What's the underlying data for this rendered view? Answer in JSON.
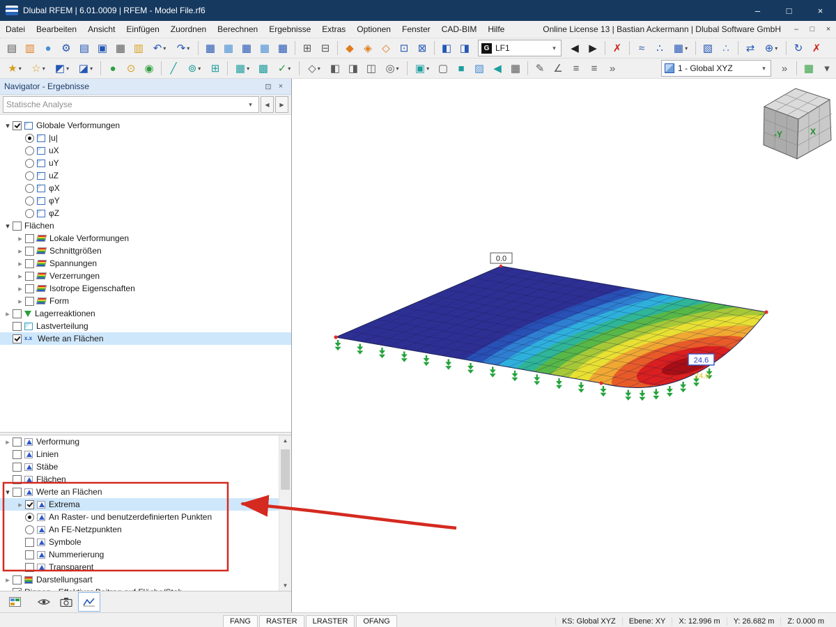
{
  "ui": {
    "dropdown_arrow": "▾",
    "nav_left": "◀",
    "nav_right": "▶",
    "scroll_up": "▲",
    "scroll_down": "▼",
    "minimize_glyph": "–",
    "restore_glyph": "□",
    "close_glyph": "×",
    "float_glyph": "⊡"
  },
  "titlebar": {
    "title": "Dlubal RFEM | 6.01.0009 | RFEM - Model File.rf6"
  },
  "menubar": {
    "items": [
      {
        "name": "menu-datei",
        "label": "Datei"
      },
      {
        "name": "menu-bearbeiten",
        "label": "Bearbeiten"
      },
      {
        "name": "menu-ansicht",
        "label": "Ansicht"
      },
      {
        "name": "menu-einfuegen",
        "label": "Einfügen"
      },
      {
        "name": "menu-zuordnen",
        "label": "Zuordnen"
      },
      {
        "name": "menu-berechnen",
        "label": "Berechnen"
      },
      {
        "name": "menu-ergebnisse",
        "label": "Ergebnisse"
      },
      {
        "name": "menu-extras",
        "label": "Extras"
      },
      {
        "name": "menu-optionen",
        "label": "Optionen"
      },
      {
        "name": "menu-fenster",
        "label": "Fenster"
      },
      {
        "name": "menu-cad-bim",
        "label": "CAD-BIM"
      },
      {
        "name": "menu-hilfe",
        "label": "Hilfe"
      }
    ],
    "right_text": "Online License 13 | Bastian Ackermann | Dlubal Software GmbH"
  },
  "toolbar1": {
    "icons_left": [
      {
        "name": "new-model-icon",
        "glyph": "▤",
        "cls": "c-gray"
      },
      {
        "name": "paste-icon",
        "glyph": "▥",
        "cls": "c-orange"
      },
      {
        "name": "dlubal-online-icon",
        "glyph": "●",
        "cls": "c-lblue"
      },
      {
        "name": "settings-icon",
        "glyph": "⚙",
        "cls": "c-blue"
      },
      {
        "name": "print-preview-icon",
        "glyph": "▤",
        "cls": "c-blue"
      },
      {
        "name": "save-icon",
        "glyph": "▣",
        "cls": "c-blue"
      },
      {
        "name": "print-icon",
        "glyph": "▦",
        "cls": "c-gray"
      },
      {
        "name": "comment-icon",
        "glyph": "▥",
        "cls": "c-yellow"
      },
      {
        "name": "undo-icon",
        "glyph": "↶",
        "cls": "c-blue has-dd"
      },
      {
        "name": "redo-icon",
        "glyph": "↷",
        "cls": "c-blue has-dd"
      },
      {
        "name": "separator",
        "cls": "sep"
      },
      {
        "name": "tables-results-icon",
        "glyph": "▦",
        "cls": "c-blue"
      },
      {
        "name": "tables-input-icon",
        "glyph": "▦",
        "cls": "c-lblue"
      },
      {
        "name": "tables-report-icon",
        "glyph": "▦",
        "cls": "c-blue"
      },
      {
        "name": "tables-display-icon",
        "glyph": "▦",
        "cls": "c-lblue"
      },
      {
        "name": "tables-export-icon",
        "glyph": "▦",
        "cls": "c-blue"
      },
      {
        "name": "separator",
        "cls": "sep"
      },
      {
        "name": "calculate-all-icon",
        "glyph": "⊞",
        "cls": "c-gray"
      },
      {
        "name": "calculation-settings-icon",
        "glyph": "⊟",
        "cls": "c-gray"
      },
      {
        "name": "separator",
        "cls": "sep"
      },
      {
        "name": "load-wizard-icon",
        "glyph": "◆",
        "cls": "c-orange"
      },
      {
        "name": "imperfection-icon",
        "glyph": "◈",
        "cls": "c-orange"
      },
      {
        "name": "combination-icon",
        "glyph": "◇",
        "cls": "c-orange"
      },
      {
        "name": "solver-icon",
        "glyph": "⊡",
        "cls": "c-blue"
      },
      {
        "name": "surface-release-icon",
        "glyph": "⊠",
        "cls": "c-blue"
      },
      {
        "name": "separator",
        "cls": "sep"
      },
      {
        "name": "partial-view-icon",
        "glyph": "◧",
        "cls": "c-blue"
      },
      {
        "name": "clipping-plane-icon",
        "glyph": "◨",
        "cls": "c-blue"
      }
    ],
    "load_case_badge": "G",
    "load_case": "LF1",
    "icons_right": [
      {
        "name": "previous-load-case-icon",
        "glyph": "◀",
        "cls": "c-dark"
      },
      {
        "name": "next-load-case-icon",
        "glyph": "▶",
        "cls": "c-dark"
      },
      {
        "name": "separator",
        "cls": "sep"
      },
      {
        "name": "delete-results-icon",
        "glyph": "✗",
        "cls": "c-red"
      },
      {
        "name": "separator",
        "cls": "sep"
      },
      {
        "name": "show-results-icon",
        "glyph": "≈",
        "cls": "c-blue"
      },
      {
        "name": "result-values-icon",
        "glyph": "∴",
        "cls": "c-blue"
      },
      {
        "name": "result-table-icon",
        "glyph": "▦",
        "cls": "c-blue has-dd"
      },
      {
        "name": "separator",
        "cls": "sep"
      },
      {
        "name": "result-diagram-icon",
        "glyph": "▧",
        "cls": "c-blue"
      },
      {
        "name": "result-grid-values-icon",
        "glyph": "∴",
        "cls": "c-lblue"
      },
      {
        "name": "separator",
        "cls": "sep"
      },
      {
        "name": "animate-deformation-icon",
        "glyph": "⇄",
        "cls": "c-blue"
      },
      {
        "name": "copy-results-icon",
        "glyph": "⊕",
        "cls": "c-blue has-dd"
      },
      {
        "name": "separator",
        "cls": "sep"
      },
      {
        "name": "refresh-icon",
        "glyph": "↻",
        "cls": "c-blue"
      },
      {
        "name": "stop-calculation-icon",
        "glyph": "✗",
        "cls": "c-red"
      }
    ]
  },
  "toolbar2": {
    "icons_left": [
      {
        "name": "select-objects-icon",
        "glyph": "★",
        "cls": "c-yellow has-dd"
      },
      {
        "name": "select-special-icon",
        "glyph": "☆",
        "cls": "c-yellow has-dd"
      },
      {
        "name": "visibility-modes-icon",
        "glyph": "◩",
        "cls": "c-blue has-dd"
      },
      {
        "name": "user-defined-views-icon",
        "glyph": "◪",
        "cls": "c-blue has-dd"
      },
      {
        "name": "separator",
        "cls": "sep"
      },
      {
        "name": "isolate-selection-icon",
        "glyph": "●",
        "cls": "c-green"
      },
      {
        "name": "numbering-icon",
        "glyph": "⊙",
        "cls": "c-yellow"
      },
      {
        "name": "show-all-icon",
        "glyph": "◉",
        "cls": "c-green"
      },
      {
        "name": "separator",
        "cls": "sep"
      },
      {
        "name": "guidelines-icon",
        "glyph": "╱",
        "cls": "c-teal"
      },
      {
        "name": "object-snap-icon",
        "glyph": "⊚",
        "cls": "c-teal has-dd"
      },
      {
        "name": "grid-icon",
        "glyph": "⊞",
        "cls": "c-teal"
      },
      {
        "name": "separator",
        "cls": "sep"
      },
      {
        "name": "fe-mesh-icon",
        "glyph": "▦",
        "cls": "c-teal has-dd"
      },
      {
        "name": "fe-mesh-settings-icon",
        "glyph": "▩",
        "cls": "c-teal"
      },
      {
        "name": "model-check-icon",
        "glyph": "✓",
        "cls": "c-green has-dd"
      },
      {
        "name": "separator",
        "cls": "sep"
      },
      {
        "name": "view-isometric-icon",
        "glyph": "◇",
        "cls": "c-gray has-dd"
      },
      {
        "name": "view-in-x-icon",
        "glyph": "◧",
        "cls": "c-gray"
      },
      {
        "name": "view-in-y-icon",
        "glyph": "◨",
        "cls": "c-gray"
      },
      {
        "name": "view-in-z-icon",
        "glyph": "◫",
        "cls": "c-gray"
      },
      {
        "name": "zoom-icon",
        "glyph": "◎",
        "cls": "c-gray has-dd"
      },
      {
        "name": "separator",
        "cls": "sep"
      },
      {
        "name": "display-style-icon",
        "glyph": "▣",
        "cls": "c-teal has-dd"
      },
      {
        "name": "wireframe-display-icon",
        "glyph": "▢",
        "cls": "c-gray"
      },
      {
        "name": "solid-display-icon",
        "glyph": "■",
        "cls": "c-teal"
      },
      {
        "name": "transparency-display-icon",
        "glyph": "▨",
        "cls": "c-lblue"
      },
      {
        "name": "section-view-icon",
        "glyph": "◀",
        "cls": "c-teal"
      },
      {
        "name": "result-table-2-icon",
        "glyph": "▦",
        "cls": "c-gray"
      },
      {
        "name": "separator",
        "cls": "sep"
      },
      {
        "name": "editing-icon",
        "glyph": "✎",
        "cls": "c-gray"
      },
      {
        "name": "measure-icon",
        "glyph": "∠",
        "cls": "c-gray"
      },
      {
        "name": "list-objects-icon",
        "glyph": "≡",
        "cls": "c-gray"
      },
      {
        "name": "list-results-icon",
        "glyph": "≡",
        "cls": "c-gray"
      },
      {
        "name": "toolbar-overflow-icon",
        "glyph": "»",
        "cls": "c-gray"
      }
    ],
    "coordinate_system": "1 - Global XYZ",
    "icons_right": [
      {
        "name": "overflow-2-icon",
        "glyph": "»",
        "cls": "c-gray"
      },
      {
        "name": "separator",
        "cls": "sep"
      },
      {
        "name": "results-grid-icon",
        "glyph": "▦",
        "cls": "c-green"
      },
      {
        "name": "more-dropdown-icon",
        "glyph": "▾",
        "cls": "c-gray"
      }
    ]
  },
  "navigator": {
    "title": "Navigator - Ergebnisse",
    "analysis_type": "Statische Analyse",
    "tree_top": [
      {
        "name": "tree-item-globale-verformungen",
        "label": "Globale Verformungen",
        "exp": "down",
        "ctl": "chk-on",
        "ico": "plate"
      },
      {
        "name": "tree-item-u-abs",
        "label": "|u|",
        "ctl": "rad-on",
        "ico": "plate",
        "cls": "ind-1"
      },
      {
        "name": "tree-item-ux",
        "label": "uX",
        "ctl": "rad",
        "ico": "plate",
        "cls": "ind-1"
      },
      {
        "name": "tree-item-uy",
        "label": "uY",
        "ctl": "rad",
        "ico": "plate",
        "cls": "ind-1"
      },
      {
        "name": "tree-item-uz",
        "label": "uZ",
        "ctl": "rad",
        "ico": "plate",
        "cls": "ind-1"
      },
      {
        "name": "tree-item-phix",
        "label": "φX",
        "ctl": "rad",
        "ico": "plate",
        "cls": "ind-1"
      },
      {
        "name": "tree-item-phiy",
        "label": "φY",
        "ctl": "rad",
        "ico": "plate",
        "cls": "ind-1"
      },
      {
        "name": "tree-item-phiz",
        "label": "φZ",
        "ctl": "rad",
        "ico": "plate",
        "cls": "ind-1"
      },
      {
        "name": "tree-item-flaechen",
        "label": "Flächen",
        "exp": "down",
        "ctl": "chk",
        "ico": "none"
      },
      {
        "name": "tree-item-lokale-verformungen",
        "label": "Lokale Verformungen",
        "exp": "right",
        "ctl": "chk",
        "ico": "rainbow",
        "cls": "ind-1"
      },
      {
        "name": "tree-item-schnittgroessen",
        "label": "Schnittgrößen",
        "exp": "right",
        "ctl": "chk",
        "ico": "rainbow",
        "cls": "ind-1"
      },
      {
        "name": "tree-item-spannungen",
        "label": "Spannungen",
        "exp": "right",
        "ctl": "chk",
        "ico": "rainbow",
        "cls": "ind-1"
      },
      {
        "name": "tree-item-verzerrungen",
        "label": "Verzerrungen",
        "exp": "right",
        "ctl": "chk",
        "ico": "rainbow",
        "cls": "ind-1"
      },
      {
        "name": "tree-item-isotrope-eigenschaften",
        "label": "Isotrope Eigenschaften",
        "exp": "right",
        "ctl": "chk",
        "ico": "rainbow",
        "cls": "ind-1"
      },
      {
        "name": "tree-item-form",
        "label": "Form",
        "exp": "right",
        "ctl": "chk",
        "ico": "rainbow",
        "cls": "ind-1"
      },
      {
        "name": "tree-item-lagerreaktionen",
        "label": "Lagerreaktionen",
        "exp": "right",
        "ctl": "chk",
        "ico": "support"
      },
      {
        "name": "tree-item-lastverteilung",
        "label": "Lastverteilung",
        "ctl": "chk",
        "ico": "dist"
      },
      {
        "name": "tree-item-werte-an-flaechen",
        "label": "Werte an Flächen",
        "ctl": "chk-on",
        "ico": "values",
        "cls": "sel"
      }
    ],
    "tree_bottom": [
      {
        "name": "tree-item-verformung",
        "label": "Verformung",
        "exp": "right",
        "ctl": "chk",
        "ico": "chart"
      },
      {
        "name": "tree-item-linien",
        "label": "Linien",
        "ctl": "chk",
        "ico": "chart"
      },
      {
        "name": "tree-item-staebe",
        "label": "Stäbe",
        "ctl": "chk",
        "ico": "chart"
      },
      {
        "name": "tree-item-flaechen-2",
        "label": "Flächen",
        "ctl": "chk",
        "ico": "chart"
      },
      {
        "name": "tree-item-werte-an-flaechen-2",
        "label": "Werte an Flächen",
        "exp": "down",
        "ctl": "chk",
        "ico": "chart"
      },
      {
        "name": "tree-item-extrema",
        "label": "Extrema",
        "exp": "right",
        "ctl": "chk-on",
        "ico": "chart",
        "cls": "ind-1 sel"
      },
      {
        "name": "tree-item-an-rasterpunkten",
        "label": "An Raster- und benutzerdefinierten Punkten",
        "ctl": "rad-on",
        "ico": "chart",
        "cls": "ind-1"
      },
      {
        "name": "tree-item-an-fe-netzpunkten",
        "label": "An FE-Netzpunkten",
        "ctl": "rad",
        "ico": "chart",
        "cls": "ind-1"
      },
      {
        "name": "tree-item-symbole",
        "label": "Symbole",
        "ctl": "chk",
        "ico": "chart",
        "cls": "ind-1"
      },
      {
        "name": "tree-item-nummerierung",
        "label": "Nummerierung",
        "ctl": "chk",
        "ico": "chart",
        "cls": "ind-1"
      },
      {
        "name": "tree-item-transparent",
        "label": "Transparent",
        "ctl": "chk",
        "ico": "chart",
        "cls": "ind-1"
      },
      {
        "name": "tree-item-darstellungsart",
        "label": "Darstellungsart",
        "exp": "right",
        "ctl": "chk",
        "ico": "rainbow2"
      },
      {
        "name": "tree-item-rippen",
        "label": "Rippen - Effektiver Beitrag auf Fläche/Stab",
        "ctl": "chk-on",
        "ico": "none"
      }
    ]
  },
  "viewport": {
    "min_value_label": "0.0",
    "max_value_label": "24.6",
    "max_value_label_secondary": "24.6",
    "cube_left_label": "-Y",
    "cube_right_label": "X",
    "legend_colors": [
      "#2e2f93",
      "#2850b5",
      "#2f7fd1",
      "#2fb0dc",
      "#2fb597",
      "#57b747",
      "#a6c838",
      "#e8e032",
      "#f0a832",
      "#e85b28",
      "#d91f1f",
      "#a80f14"
    ],
    "support_color": "#23a33b",
    "annotation_color": "#d42a20"
  },
  "statusbar": {
    "snap_toggles": [
      {
        "name": "fang-toggle",
        "label": "FANG"
      },
      {
        "name": "raster-toggle",
        "label": "RASTER"
      },
      {
        "name": "lraster-toggle",
        "label": "LRASTER"
      },
      {
        "name": "ofang-toggle",
        "label": "OFANG"
      }
    ],
    "coordinate_system": "KS: Global XYZ",
    "plane": "Ebene: XY",
    "x": "X: 12.996 m",
    "y": "Y: 26.682 m",
    "z": "Z: 0.000 m"
  }
}
